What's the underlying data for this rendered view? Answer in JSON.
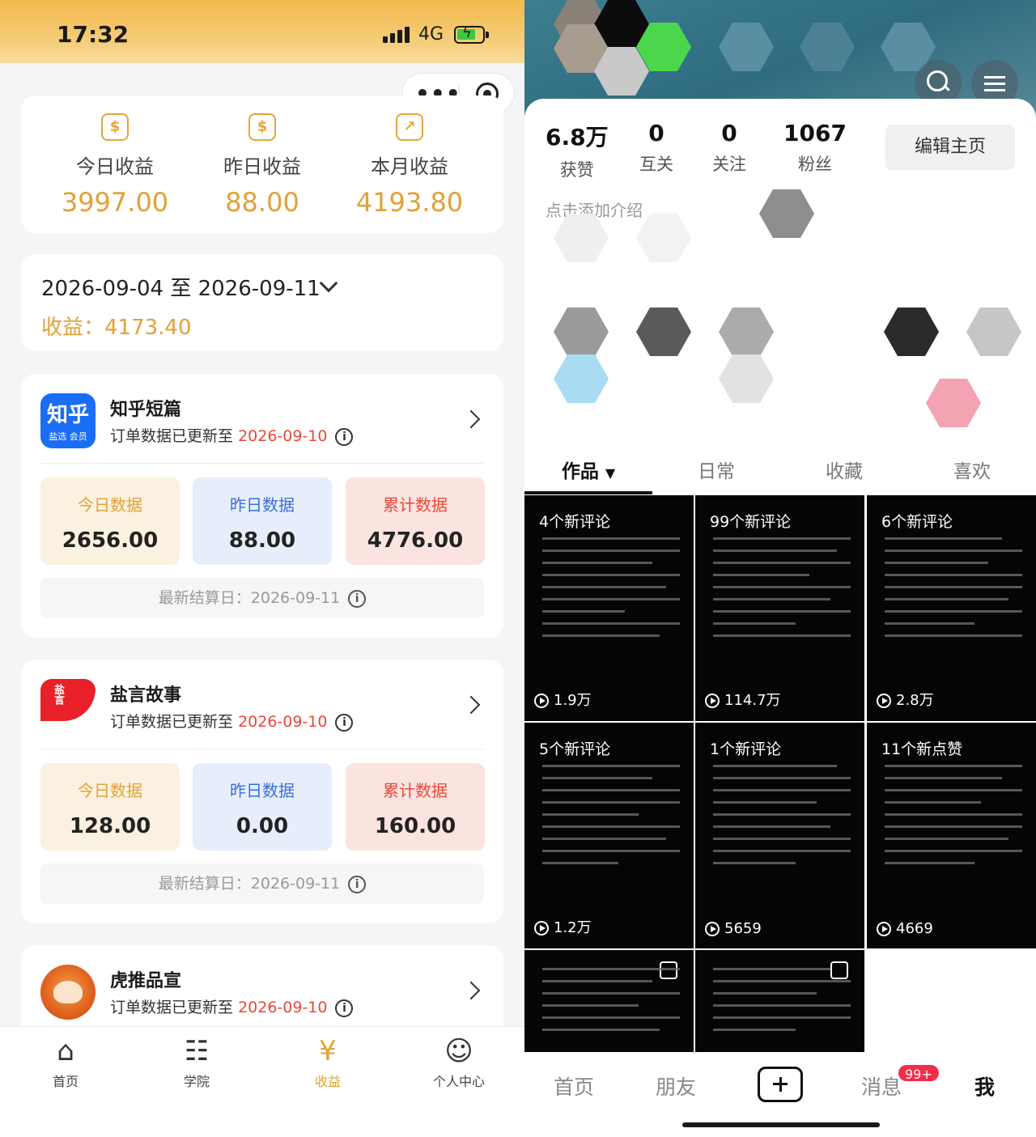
{
  "left": {
    "status_bar": {
      "time": "17:32",
      "network": "4G"
    },
    "earnings": [
      {
        "label": "今日收益",
        "value": "3997.00",
        "icon": "dollar-coin-icon"
      },
      {
        "label": "昨日收益",
        "value": "88.00",
        "icon": "monitor-dollar-icon"
      },
      {
        "label": "本月收益",
        "value": "4193.80",
        "icon": "growth-chart-icon"
      }
    ],
    "date_range": {
      "text": "2026-09-04 至 2026-09-11",
      "income": "收益：4173.40"
    },
    "platforms": [
      {
        "name": "知乎短篇",
        "logo_text": "知乎",
        "logo_sub": "盐选 会员",
        "update_prefix": "订单数据已更新至",
        "update_date": "2026-09-10",
        "stats": [
          {
            "label": "今日数据",
            "value": "2656.00"
          },
          {
            "label": "昨日数据",
            "value": "88.00"
          },
          {
            "label": "累计数据",
            "value": "4776.00"
          }
        ],
        "settle": "最新结算日：2026-09-11"
      },
      {
        "name": "盐言故事",
        "logo_text": "盐言",
        "update_prefix": "订单数据已更新至",
        "update_date": "2026-09-10",
        "stats": [
          {
            "label": "今日数据",
            "value": "128.00"
          },
          {
            "label": "昨日数据",
            "value": "0.00"
          },
          {
            "label": "累计数据",
            "value": "160.00"
          }
        ],
        "settle": "最新结算日：2026-09-11"
      },
      {
        "name": "虎推品宣",
        "update_prefix": "订单数据已更新至",
        "update_date": "2026-09-10"
      }
    ],
    "tabbar": [
      {
        "label": "首页",
        "icon": "home-icon"
      },
      {
        "label": "学院",
        "icon": "academy-icon"
      },
      {
        "label": "收益",
        "icon": "money-bag-icon",
        "active": true
      },
      {
        "label": "个人中心",
        "icon": "person-icon"
      }
    ],
    "colors": {
      "accent": "#e2a137",
      "date_red": "#e8483a",
      "blue": "#3a6fd8"
    }
  },
  "right": {
    "stats": [
      {
        "value": "6.8万",
        "label": "获赞"
      },
      {
        "value": "0",
        "label": "互关"
      },
      {
        "value": "0",
        "label": "关注"
      },
      {
        "value": "1067",
        "label": "粉丝"
      }
    ],
    "edit_button": "编辑主页",
    "bio_hint": "点击添加介绍",
    "tabs": [
      "作品",
      "日常",
      "收藏",
      "喜欢"
    ],
    "active_tab_arrow": "▼",
    "videos": [
      {
        "head": "4个新评论",
        "plays": "1.9万"
      },
      {
        "head": "99个新评论",
        "plays": "114.7万"
      },
      {
        "head": "6个新评论",
        "plays": "2.8万"
      },
      {
        "head": "5个新评论",
        "plays": "1.2万"
      },
      {
        "head": "1个新评论",
        "plays": "5659"
      },
      {
        "head": "11个新点赞",
        "plays": "4669"
      },
      {
        "head": "",
        "plays": ""
      },
      {
        "head": "",
        "plays": ""
      }
    ],
    "bottom_nav": {
      "home": "首页",
      "friends": "朋友",
      "messages": "消息",
      "badge": "99+",
      "me": "我"
    }
  }
}
